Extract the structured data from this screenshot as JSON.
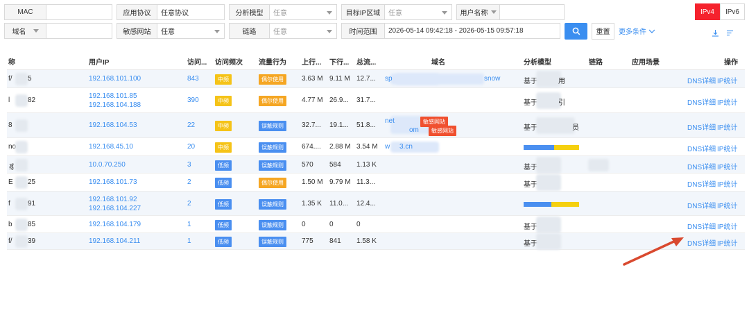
{
  "filters": {
    "mac": {
      "label": "MAC",
      "value": ""
    },
    "protocol": {
      "label": "应用协议",
      "value": "任意协议"
    },
    "model": {
      "label": "分析模型",
      "value": "任意"
    },
    "target": {
      "label": "目标IP区域",
      "value": "任意"
    },
    "username": {
      "label": "用户名称",
      "value": ""
    },
    "domain": {
      "label": "域名",
      "value": ""
    },
    "sensitive": {
      "label": "敏感网站",
      "value": "任意"
    },
    "link": {
      "label": "链路",
      "value": "任意"
    },
    "time": {
      "label": "时间范围",
      "value": "2026-05-14 09:42:18 - 2026-05-15 09:57:18"
    },
    "reset": "重置",
    "more": "更多条件"
  },
  "ipv": {
    "v4": "IPv4",
    "v6": "IPv6"
  },
  "headers": {
    "name": "称",
    "ip": "用户IP",
    "visits": "访问...",
    "freq": "访问频次",
    "behavior": "流量行为",
    "up": "上行...",
    "down": "下行...",
    "total": "总流...",
    "domain": "域名",
    "model": "分析模型",
    "link": "链路",
    "scene": "应用场景",
    "ops": "操作"
  },
  "ops": {
    "dns": "DNS详细",
    "ip": "IP统计"
  },
  "rows": [
    {
      "name_a": "f/",
      "name_b": "5",
      "ip1": "192.168.101.100",
      "ip2": "",
      "visits": "843",
      "freq": "中频",
      "freq_type": "mid",
      "behavior": "偶尔使用",
      "beh_type": "yellow",
      "up": "3.63 M",
      "down": "9.11 M",
      "total": "12.7...",
      "dom1": "sp",
      "dom2": "snow",
      "tag1": "",
      "tag2": "",
      "model": "基于",
      "model2": "用"
    },
    {
      "name_a": "l",
      "name_b": "82",
      "ip1": "192.168.101.85",
      "ip2": "192.168.104.188",
      "visits": "390",
      "freq": "中频",
      "freq_type": "mid",
      "behavior": "偶尔使用",
      "beh_type": "yellow",
      "up": "4.77 M",
      "down": "26.9...",
      "total": "31.7...",
      "dom1": "",
      "dom2": "",
      "tag1": "",
      "tag2": "",
      "model": "基于",
      "model2": "引"
    },
    {
      "name_a": "8",
      "name_b": "",
      "ip1": "192.168.104.53",
      "ip2": "",
      "visits": "22",
      "freq": "中频",
      "freq_type": "mid",
      "behavior": "误触规则",
      "beh_type": "blue",
      "up": "32.7...",
      "down": "19.1...",
      "total": "51.8...",
      "dom1": "net",
      "dom2": "om",
      "tag1": "敏感网站",
      "tag2": "敏感网站",
      "model": "基于",
      "model2": "员"
    },
    {
      "name_a": "no",
      "name_b": "",
      "ip1": "192.168.45.10",
      "ip2": "",
      "visits": "20",
      "freq": "中频",
      "freq_type": "mid",
      "behavior": "误触规则",
      "beh_type": "blue",
      "up": "674....",
      "down": "2.88 M",
      "total": "3.54 M",
      "dom1": "w",
      "dom2": "3.cn",
      "tag1": "",
      "tag2": "",
      "model": "",
      "model2": ""
    },
    {
      "name_a": "豸",
      "name_b": "",
      "ip1": "10.0.70.250",
      "ip2": "",
      "visits": "3",
      "freq": "低频",
      "freq_type": "low",
      "behavior": "误触规则",
      "beh_type": "blue",
      "up": "570",
      "down": "584",
      "total": "1.13 K",
      "dom1": "",
      "dom2": "",
      "tag1": "",
      "tag2": "",
      "model": "基于",
      "model2": ""
    },
    {
      "name_a": "E",
      "name_b": "25",
      "ip1": "192.168.101.73",
      "ip2": "",
      "visits": "2",
      "freq": "低频",
      "freq_type": "low",
      "behavior": "偶尔使用",
      "beh_type": "yellow",
      "up": "1.50 M",
      "down": "9.79 M",
      "total": "11.3...",
      "dom1": "",
      "dom2": "",
      "tag1": "",
      "tag2": "",
      "model": "基于",
      "model2": ""
    },
    {
      "name_a": "f",
      "name_b": "91",
      "ip1": "192.168.101.92",
      "ip2": "192.168.104.227",
      "visits": "2",
      "freq": "低频",
      "freq_type": "low",
      "behavior": "误触规则",
      "beh_type": "blue",
      "up": "1.35 K",
      "down": "11.0...",
      "total": "12.4...",
      "dom1": "",
      "dom2": "",
      "tag1": "",
      "tag2": "",
      "model": "",
      "model2": ""
    },
    {
      "name_a": "b",
      "name_b": "85",
      "ip1": "192.168.104.179",
      "ip2": "",
      "visits": "1",
      "freq": "低频",
      "freq_type": "low",
      "behavior": "误触规则",
      "beh_type": "blue",
      "up": "0",
      "down": "0",
      "total": "0",
      "dom1": "",
      "dom2": "",
      "tag1": "",
      "tag2": "",
      "model": "基于",
      "model2": ""
    },
    {
      "name_a": "f/",
      "name_b": "39",
      "ip1": "192.168.104.211",
      "ip2": "",
      "visits": "1",
      "freq": "低频",
      "freq_type": "low",
      "behavior": "误触规则",
      "beh_type": "blue",
      "up": "775",
      "down": "841",
      "total": "1.58 K",
      "dom1": "",
      "dom2": "",
      "tag1": "",
      "tag2": "",
      "model": "基于",
      "model2": ""
    }
  ],
  "model_bars": [
    {
      "row": 3,
      "blue": 0.55,
      "yellow": 0.45
    },
    {
      "row": 6,
      "blue": 0.5,
      "yellow": 0.5
    }
  ],
  "colors": {
    "accent": "#3a8ef0",
    "ipv4": "#f5222d",
    "mid": "#f5c318",
    "low": "#4a8ff0",
    "sensitive": "#f0502f",
    "arrow": "#d9492f"
  }
}
